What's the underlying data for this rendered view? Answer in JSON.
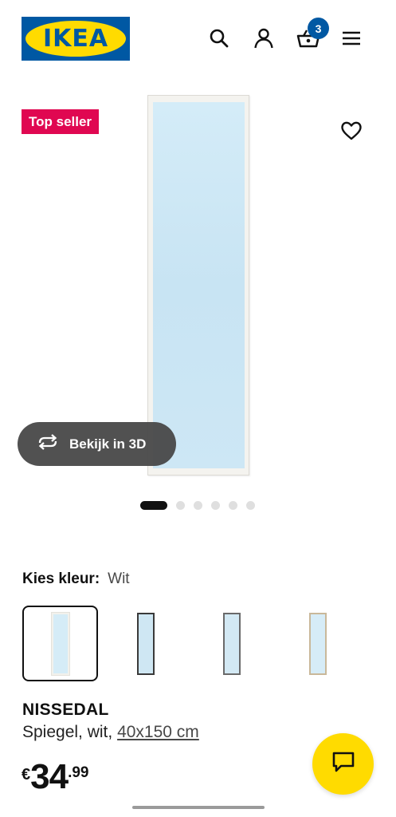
{
  "header": {
    "logo_text": "IKEA",
    "icons": [
      "search-icon",
      "user-icon",
      "basket-icon",
      "menu-icon"
    ],
    "cart_count": "3"
  },
  "product_media": {
    "badge": "Top seller",
    "view_3d_label": "Bekijk in 3D",
    "carousel": {
      "total": 6,
      "active_index": 0
    }
  },
  "color_selector": {
    "label": "Kies kleur:",
    "selected_value": "Wit",
    "options": [
      "white",
      "black",
      "grey",
      "wood"
    ]
  },
  "product": {
    "name": "NISSEDAL",
    "description": "Spiegel, wit,",
    "size_link": "40x150 cm",
    "price": {
      "currency": "€",
      "integer": "34",
      "decimals": ".99"
    }
  },
  "colors": {
    "ikea_blue": "#0058a3",
    "ikea_yellow": "#ffdb00",
    "badge_red": "#e00751"
  }
}
